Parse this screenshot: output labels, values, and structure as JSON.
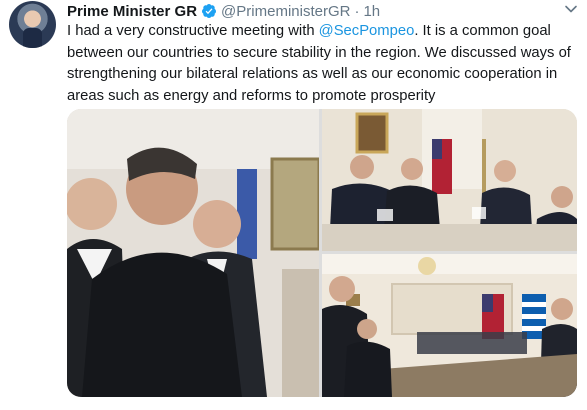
{
  "tweet": {
    "author_name": "Prime Minister GR",
    "handle": "@PrimeministerGR",
    "separator": "·",
    "time": "1h",
    "text_before": "I had a very constructive meeting with ",
    "mention": "@SecPompeo",
    "text_after": ". It is a common goal between our countries to secure stability in the region. We discussed ways of strengthening our bilateral relations as well as our economic cooperation in areas such as energy and reforms to promote prosperity"
  },
  "icons": {
    "verified": "verified-badge-icon",
    "menu": "chevron-down-icon"
  },
  "colors": {
    "text": "#14171a",
    "muted": "#657786",
    "link": "#1b95e0",
    "verified": "#1da1f2"
  }
}
